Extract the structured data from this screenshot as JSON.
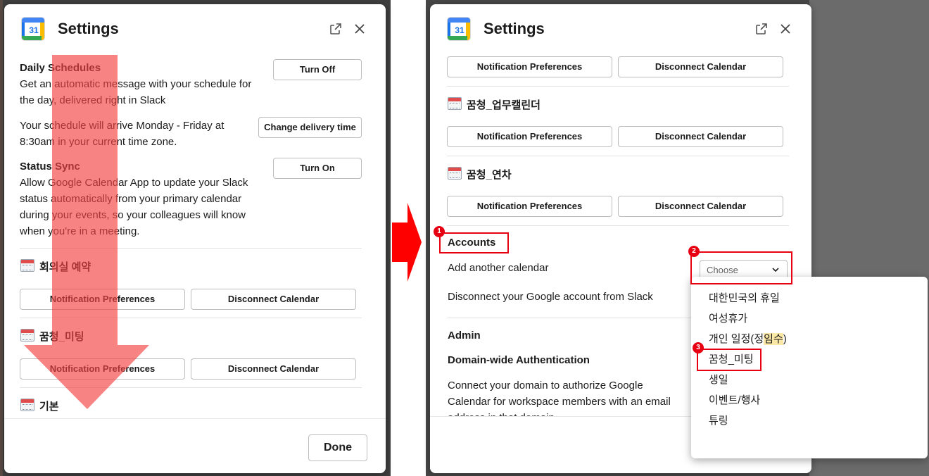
{
  "colors": {
    "accent_red": "#e60012",
    "arrow_red": "#f24040",
    "calendar_blue": "#4285f4"
  },
  "left_panel": {
    "header": {
      "app_icon_number": "31",
      "title": "Settings",
      "external_icon": "external-link-icon",
      "close_icon": "close-icon"
    },
    "daily_schedules": {
      "title": "Daily Schedules",
      "desc_line1": "Get an automatic message with your schedule for",
      "desc_line2": "the day, delivered right in Slack",
      "toggle_label": "Turn Off",
      "delivery_line1": "Your schedule will arrive Monday - Friday at",
      "delivery_line2": "8:30am in your current time zone.",
      "change_label": "Change delivery time"
    },
    "status_sync": {
      "title": "Status Sync",
      "line1": "Allow Google Calendar App to update your Slack",
      "line2": "status automatically from your primary calendar",
      "line3": "during your events, so your colleagues will know",
      "line4": "when you're in a meeting.",
      "toggle_label": "Turn On"
    },
    "calendars": [
      {
        "name": "회의실 예약",
        "notif_label": "Notification Preferences",
        "disconnect_label": "Disconnect Calendar"
      },
      {
        "name": "꿈청_미팅",
        "notif_label": "Notification Preferences",
        "disconnect_label": "Disconnect Calendar"
      },
      {
        "name": "기본"
      }
    ],
    "footer": {
      "done_label": "Done"
    }
  },
  "right_panel": {
    "header": {
      "app_icon_number": "31",
      "title": "Settings"
    },
    "top_buttons": {
      "notif_label": "Notification Preferences",
      "disconnect_label": "Disconnect Calendar"
    },
    "calendars": [
      {
        "name": "꿈청_업무캘린더",
        "notif_label": "Notification Preferences",
        "disconnect_label": "Disconnect Calendar"
      },
      {
        "name": "꿈청_연차",
        "notif_label": "Notification Preferences",
        "disconnect_label": "Disconnect Calendar"
      }
    ],
    "accounts": {
      "title": "Accounts",
      "add_label": "Add another calendar",
      "disconnect_account_label": "Disconnect your Google account from Slack",
      "choose_placeholder": "Choose"
    },
    "admin": {
      "title": "Admin",
      "domain_title": "Domain-wide Authentication",
      "line1": "Connect your domain to authorize Google",
      "line2": "Calendar for workspace members with an email",
      "line3": "address in that domain."
    },
    "dropdown_options": [
      "대한민국의 휴일",
      "여성휴가",
      "개인 일정(정",
      "꿈청_미팅",
      "생일",
      "이벤트/행사",
      "튜링"
    ],
    "dropdown_highlight": "임수",
    "dropdown_suffix": ")",
    "markers": [
      "1",
      "2",
      "3"
    ]
  }
}
